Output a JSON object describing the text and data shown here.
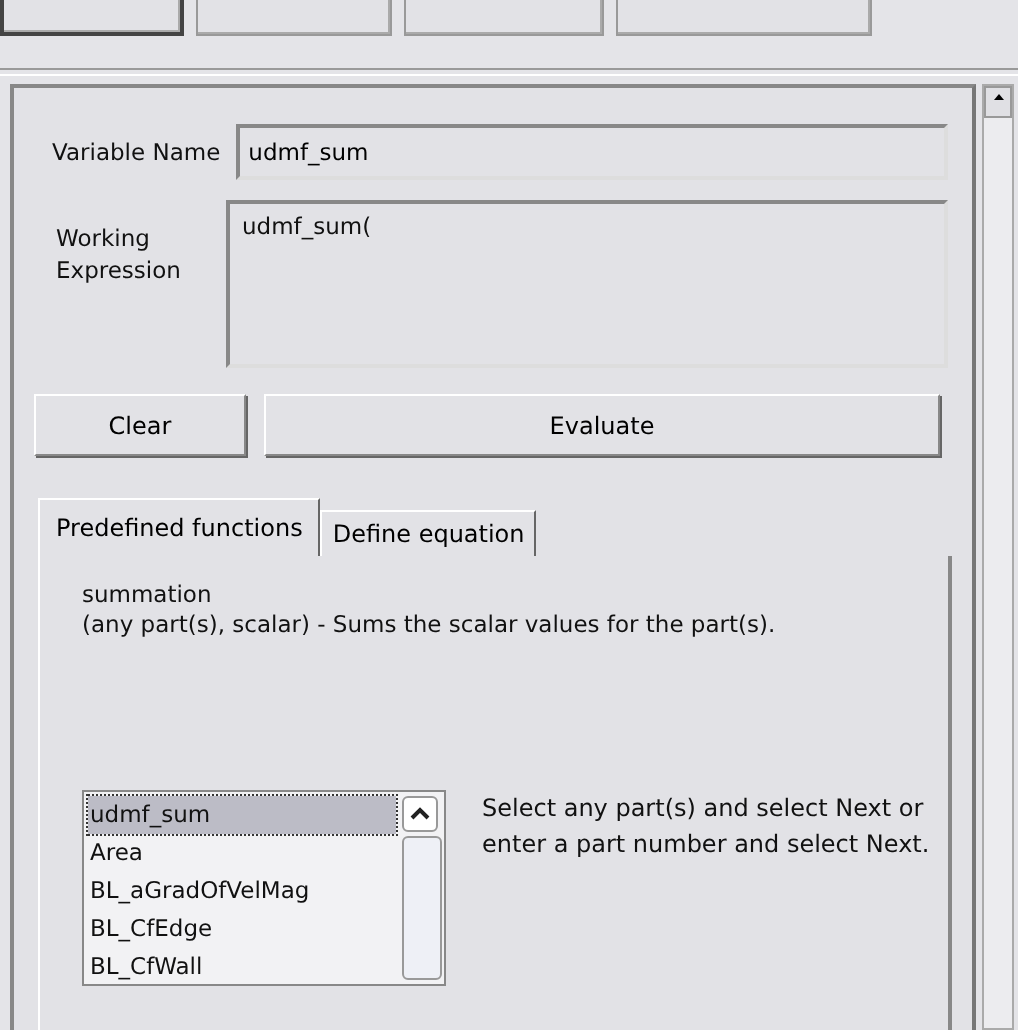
{
  "top_buttons": [
    {
      "pressed": true
    },
    {
      "pressed": false
    },
    {
      "pressed": false
    },
    {
      "pressed": false
    }
  ],
  "variable_name": {
    "label": "Variable Name",
    "value": "udmf_sum"
  },
  "working_expression": {
    "label": "Working\nExpression",
    "value": "udmf_sum("
  },
  "buttons": [
    {
      "kind": "clear",
      "label": "Clear"
    },
    {
      "kind": "evaluate",
      "label": "Evaluate"
    }
  ],
  "tabs": [
    {
      "label": "Predefined functions",
      "selected": true
    },
    {
      "label": "Define equation",
      "selected": false
    }
  ],
  "function": {
    "name": "summation",
    "description": "(any part(s), scalar) - Sums the scalar values for the part(s)."
  },
  "parts_list": [
    {
      "label": "udmf_sum",
      "selected": true
    },
    {
      "label": "Area",
      "selected": false
    },
    {
      "label": "BL_aGradOfVelMag",
      "selected": false
    },
    {
      "label": "BL_CfEdge",
      "selected": false
    },
    {
      "label": "BL_CfWall",
      "selected": false
    }
  ],
  "instructions": "Select any part(s) and select Next or enter a part number and select Next."
}
